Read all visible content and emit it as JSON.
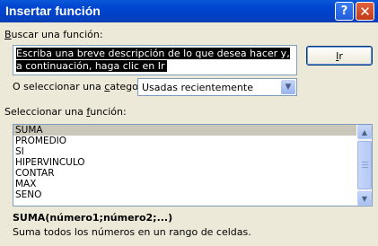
{
  "window": {
    "title": "Insertar función",
    "help_symbol": "?",
    "close_symbol": "✕"
  },
  "search": {
    "label_access": "B",
    "label_rest": "uscar una función:",
    "value": "Escriba una breve descripción de lo que desea hacer y, a continuación, haga clic en Ir",
    "go_button_access": "I",
    "go_button_rest": "r"
  },
  "category": {
    "label_pre": "O seleccionar una ",
    "label_access": "c",
    "label_post": "ategoría:",
    "selected": "Usadas recientemente"
  },
  "function_list": {
    "label_pre": "Seleccionar una ",
    "label_access": "f",
    "label_post": "unción:",
    "items": [
      "SUMA",
      "PROMEDIO",
      "SI",
      "HIPERVINCULO",
      "CONTAR",
      "MAX",
      "SENO"
    ],
    "selected_index": 0
  },
  "details": {
    "syntax": "SUMA(número1;número2;...)",
    "description": "Suma todos los números en un rango de celdas."
  },
  "icons": {
    "dropdown": "chevron-down-icon",
    "scroll_up": "arrow-up-icon",
    "scroll_down": "arrow-down-icon"
  }
}
